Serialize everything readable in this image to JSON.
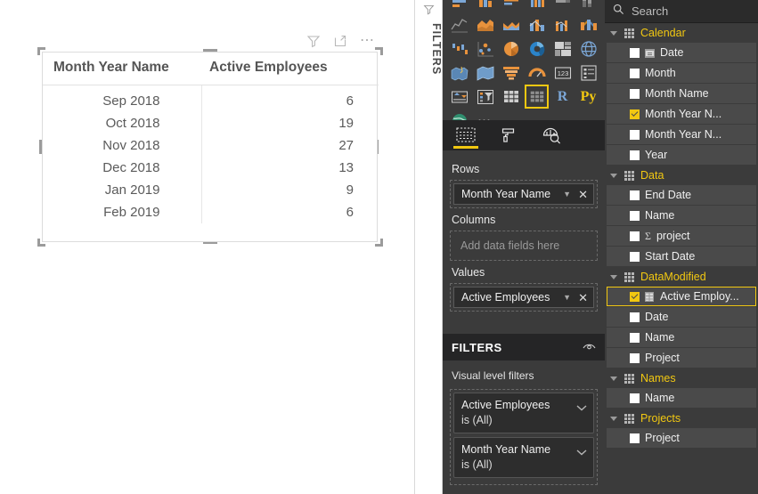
{
  "canvas": {
    "visual_header_icons": [
      "filter-icon",
      "focus-mode-icon",
      "more-options-icon"
    ],
    "matrix": {
      "columns": [
        "Month Year Name",
        "Active Employees"
      ],
      "rows": [
        {
          "month": "Sep 2018",
          "value": "6"
        },
        {
          "month": "Oct 2018",
          "value": "19"
        },
        {
          "month": "Nov 2018",
          "value": "27"
        },
        {
          "month": "Dec 2018",
          "value": "13"
        },
        {
          "month": "Jan 2019",
          "value": "9"
        },
        {
          "month": "Feb 2019",
          "value": "6"
        }
      ]
    }
  },
  "filters_tab": {
    "label": "FILTERS"
  },
  "visualizations": {
    "selected_visual": "matrix",
    "gallery_icons": [
      "stacked-bar-chart-icon",
      "stacked-column-chart-icon",
      "clustered-bar-chart-icon",
      "clustered-column-chart-icon",
      "100-stacked-bar-chart-icon",
      "100-stacked-column-chart-icon",
      "line-chart-icon",
      "area-chart-icon",
      "stacked-area-chart-icon",
      "line-stacked-column-chart-icon",
      "line-clustered-column-chart-icon",
      "ribbon-chart-icon",
      "waterfall-chart-icon",
      "scatter-chart-icon",
      "pie-chart-icon",
      "donut-chart-icon",
      "treemap-icon",
      "map-icon",
      "filled-map-icon",
      "shape-map-icon",
      "funnel-chart-icon",
      "gauge-chart-icon",
      "card-icon",
      "multi-row-card-icon",
      "kpi-icon",
      "slicer-icon",
      "table-icon",
      "matrix-icon",
      "r-script-visual-icon",
      "python-visual-icon",
      "arcgis-map-icon",
      "more-visuals-icon"
    ],
    "tabs": [
      {
        "name": "fields-tab",
        "icon": "fields-icon",
        "active": true
      },
      {
        "name": "format-tab",
        "icon": "paint-roller-icon",
        "active": false
      },
      {
        "name": "analytics-tab",
        "icon": "magnifier-chart-icon",
        "active": false
      }
    ],
    "wells": {
      "rows": {
        "label": "Rows",
        "chips": [
          "Month Year Name"
        ]
      },
      "columns": {
        "label": "Columns",
        "placeholder": "Add data fields here",
        "chips": []
      },
      "values": {
        "label": "Values",
        "chips": [
          "Active Employees"
        ]
      }
    }
  },
  "filters_panel": {
    "title": "FILTERS",
    "eye_icon": "eye-icon",
    "section_label": "Visual level filters",
    "cards": [
      {
        "name": "Active Employees",
        "state": "is (All)"
      },
      {
        "name": "Month Year Name",
        "state": "is (All)"
      }
    ]
  },
  "fields_pane": {
    "search": {
      "placeholder": "Search",
      "icon": "search-icon"
    },
    "tables": [
      {
        "name": "Calendar",
        "fields": [
          {
            "label": "Date",
            "checked": false,
            "icon": "date-hierarchy-icon"
          },
          {
            "label": "Month",
            "checked": false
          },
          {
            "label": "Month Name",
            "checked": false
          },
          {
            "label": "Month Year N...",
            "checked": true
          },
          {
            "label": "Month Year N...",
            "checked": false
          },
          {
            "label": "Year",
            "checked": false
          }
        ]
      },
      {
        "name": "Data",
        "fields": [
          {
            "label": "End Date",
            "checked": false
          },
          {
            "label": "Name",
            "checked": false
          },
          {
            "label": "project",
            "checked": false,
            "icon": "sigma-icon"
          },
          {
            "label": "Start Date",
            "checked": false
          }
        ]
      },
      {
        "name": "DataModified",
        "fields": [
          {
            "label": "Active Employ...",
            "checked": true,
            "icon": "measure-icon",
            "selected": true
          },
          {
            "label": "Date",
            "checked": false
          },
          {
            "label": "Name",
            "checked": false
          },
          {
            "label": "Project",
            "checked": false
          }
        ]
      },
      {
        "name": "Names",
        "fields": [
          {
            "label": "Name",
            "checked": false
          }
        ]
      },
      {
        "name": "Projects",
        "fields": [
          {
            "label": "Project",
            "checked": false
          }
        ]
      }
    ]
  },
  "colors": {
    "accent_yellow": "#f2c811",
    "pane_background": "#3b3b3b",
    "dark_header": "#252526",
    "field_row": "#4a4a4a",
    "canvas": "#ffffff"
  }
}
